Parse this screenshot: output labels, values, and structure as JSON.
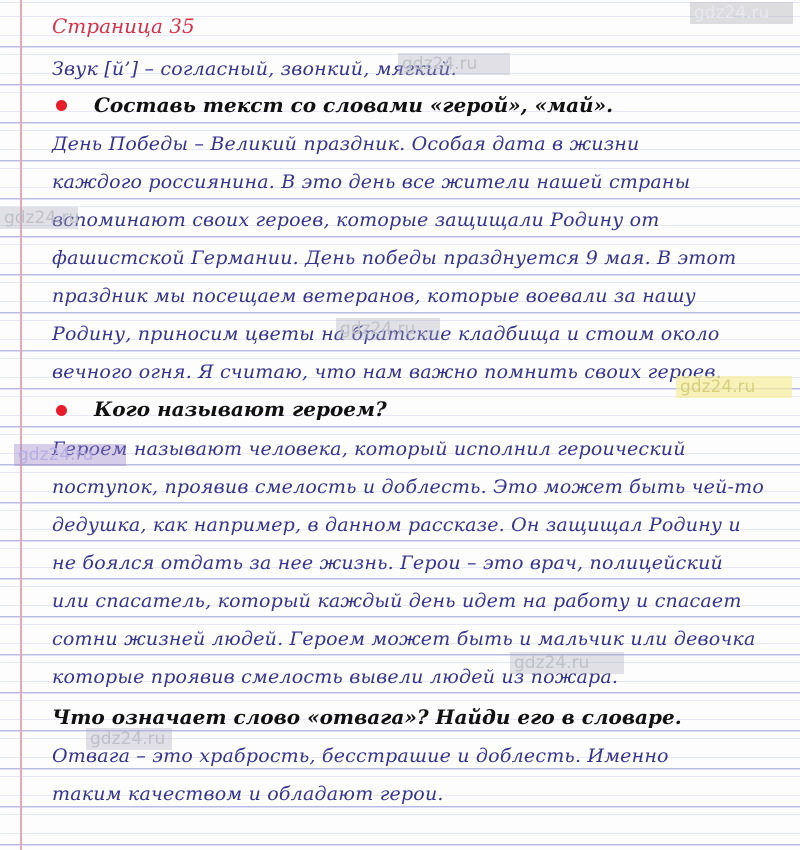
{
  "page_title": "Страница 35",
  "sound_line": "Звук [й’] – согласный, звонкий, мягкий.",
  "task1": "Составь текст со словами «герой», «май».",
  "answer1_lines": [
    "День Победы – Великий праздник. Особая дата в жизни",
    "каждого россиянина. В это день все жители нашей страны",
    "вспоминают своих героев, которые защищали Родину от",
    "фашистской Германии. День победы празднуется 9 мая. В этот",
    "праздник мы посещаем ветеранов, которые воевали за нашу",
    "Родину, приносим цветы на братские кладбища и стоим около",
    "вечного огня. Я считаю, что нам важно помнить своих героев."
  ],
  "task2": "Кого называют героем?",
  "answer2_lines": [
    "Героем называют человека, который исполнил героический",
    "поступок, проявив смелость и доблесть. Это может быть чей-то",
    "дедушка, как например, в данном рассказе. Он защищал Родину и",
    "не боялся отдать за нее жизнь. Герои – это врач, полицейский",
    "или спасатель, который каждый день идет на работу и спасает",
    "сотни жизней людей. Героем может быть и мальчик или девочка",
    "которые проявив смелость вывели людей из пожара."
  ],
  "task3": "Что означает слово «отвага»? Найди его в словаре.",
  "answer3_lines": [
    "Отвага – это храбрость, бесстрашие и доблесть. Именно",
    "таким качеством и обладают герои."
  ],
  "watermark": "gdz24.ru",
  "colors": {
    "handwriting": "#35348e",
    "heading_red": "#d9304a",
    "bullet": "#e81d2c",
    "task_text": "#111111"
  }
}
